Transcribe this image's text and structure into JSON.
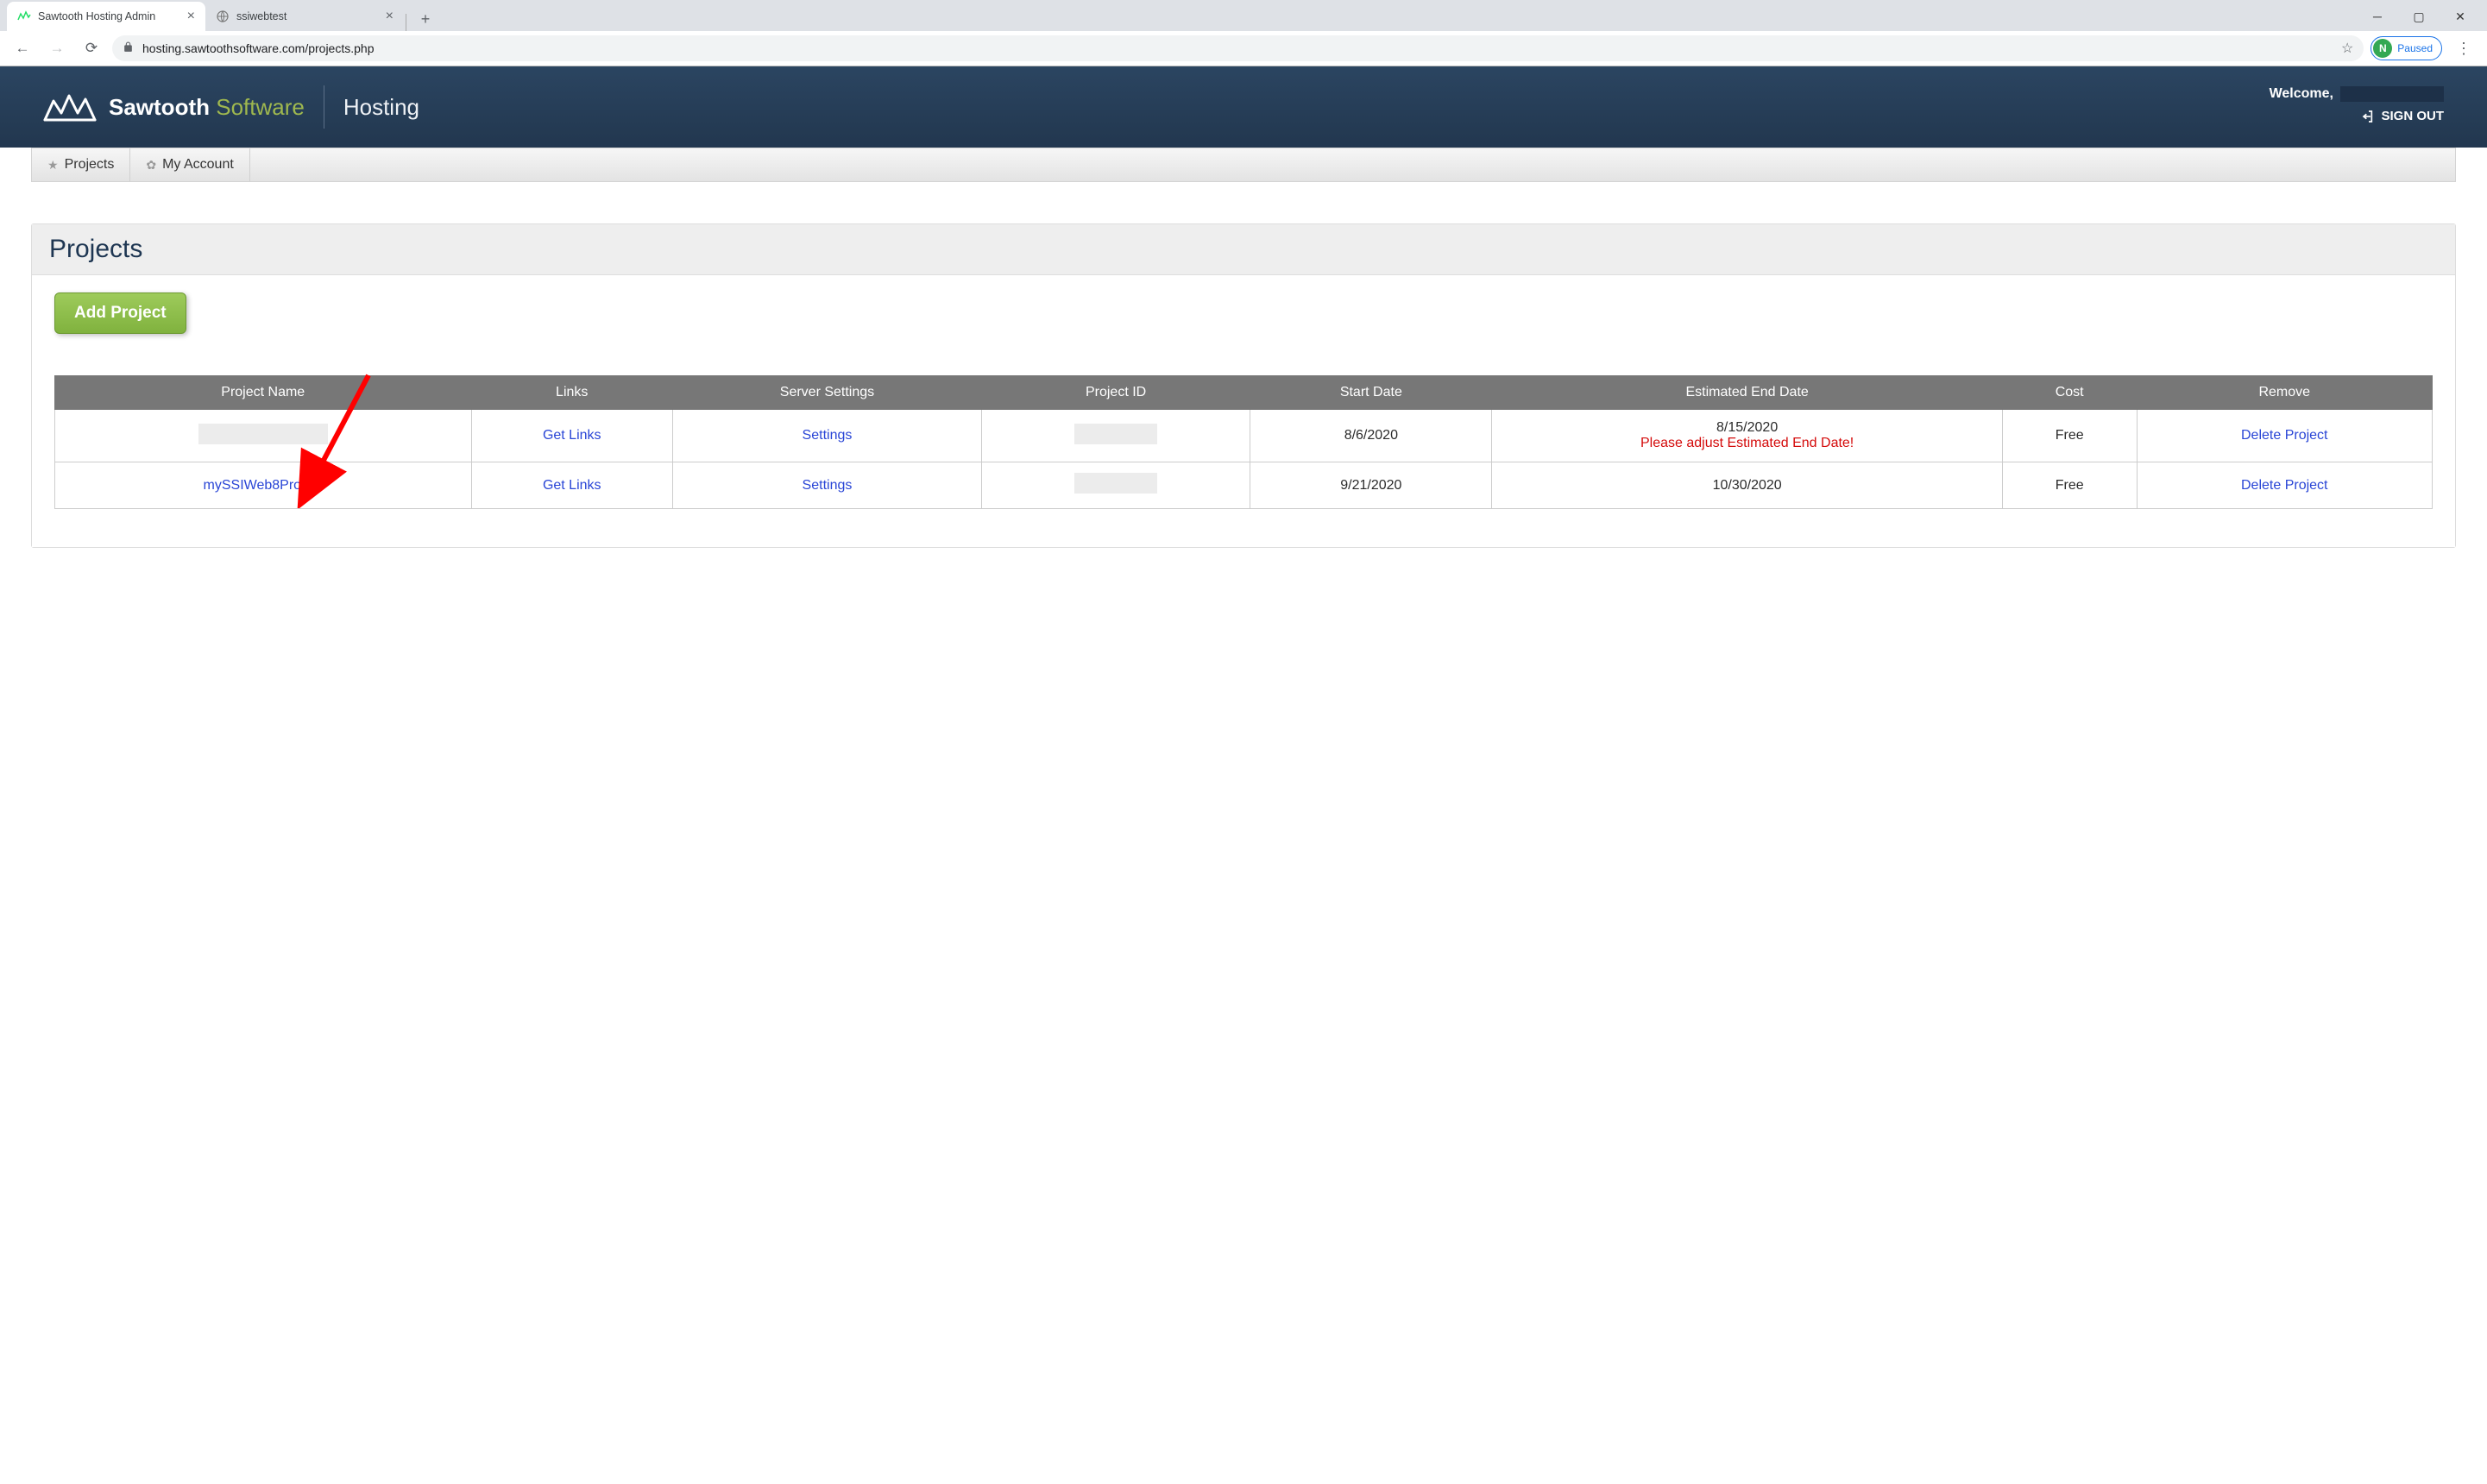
{
  "browser": {
    "tabs": [
      {
        "title": "Sawtooth Hosting Admin",
        "active": true
      },
      {
        "title": "ssiwebtest",
        "active": false
      }
    ],
    "url": "hosting.sawtoothsoftware.com/projects.php",
    "profile_letter": "N",
    "profile_status": "Paused"
  },
  "header": {
    "brand_primary": "Sawtooth",
    "brand_secondary": "Software",
    "section": "Hosting",
    "welcome": "Welcome,",
    "signout": "SIGN OUT"
  },
  "nav": {
    "projects": "Projects",
    "my_account": "My Account"
  },
  "page": {
    "title": "Projects",
    "add_button": "Add Project"
  },
  "table": {
    "headers": {
      "project_name": "Project Name",
      "links": "Links",
      "server_settings": "Server Settings",
      "project_id": "Project ID",
      "start_date": "Start Date",
      "estimated_end_date": "Estimated End Date",
      "cost": "Cost",
      "remove": "Remove"
    },
    "rows": [
      {
        "project_name": "",
        "project_name_redacted": true,
        "links_label": "Get Links",
        "settings_label": "Settings",
        "project_id": "",
        "project_id_redacted": true,
        "start_date": "8/6/2020",
        "end_date": "8/15/2020",
        "end_warning": "Please adjust Estimated End Date!",
        "cost": "Free",
        "remove_label": "Delete Project"
      },
      {
        "project_name": "mySSIWeb8Project",
        "project_name_redacted": false,
        "links_label": "Get Links",
        "settings_label": "Settings",
        "project_id": "",
        "project_id_redacted": true,
        "start_date": "9/21/2020",
        "end_date": "10/30/2020",
        "end_warning": "",
        "cost": "Free",
        "remove_label": "Delete Project"
      }
    ]
  }
}
